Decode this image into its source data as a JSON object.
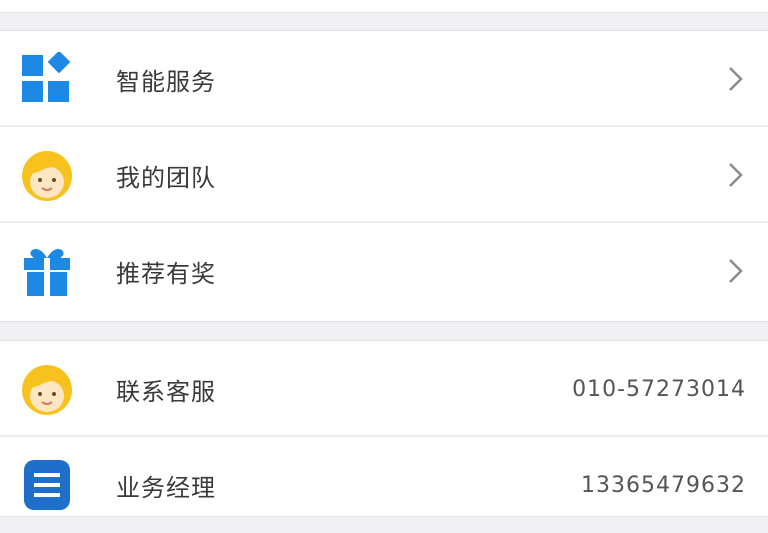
{
  "menu": {
    "items": [
      {
        "label": "智能服务",
        "icon": "grid-apps-icon"
      },
      {
        "label": "我的团队",
        "icon": "team-face-icon"
      },
      {
        "label": "推荐有奖",
        "icon": "gift-icon"
      }
    ]
  },
  "contacts": {
    "items": [
      {
        "label": "联系客服",
        "value": "010-57273014",
        "icon": "customer-service-face-icon"
      },
      {
        "label": "业务经理",
        "value": "13365479632",
        "icon": "manager-list-icon"
      }
    ]
  },
  "colors": {
    "blue": "#1e88e5",
    "yellow": "#f7c21d",
    "background": "#f0f0f2"
  }
}
